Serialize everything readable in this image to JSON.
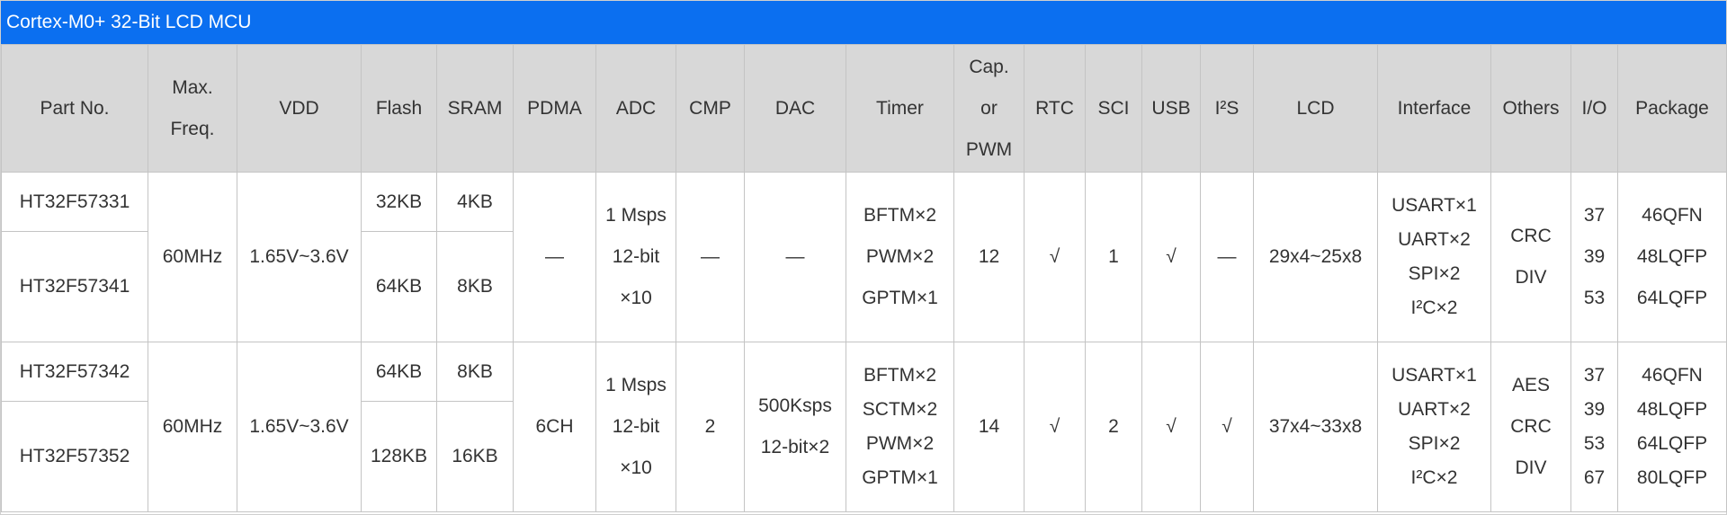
{
  "title": "Cortex-M0+ 32-Bit LCD MCU",
  "headers": [
    {
      "lines": [
        "Part No."
      ]
    },
    {
      "lines": [
        "Max.",
        "Freq."
      ]
    },
    {
      "lines": [
        "VDD"
      ]
    },
    {
      "lines": [
        "Flash"
      ]
    },
    {
      "lines": [
        "SRAM"
      ]
    },
    {
      "lines": [
        "PDMA"
      ]
    },
    {
      "lines": [
        "ADC"
      ]
    },
    {
      "lines": [
        "CMP"
      ]
    },
    {
      "lines": [
        "DAC"
      ]
    },
    {
      "lines": [
        "Timer"
      ]
    },
    {
      "lines": [
        "Cap.",
        "or",
        "PWM"
      ]
    },
    {
      "lines": [
        "RTC"
      ]
    },
    {
      "lines": [
        "SCI"
      ]
    },
    {
      "lines": [
        "USB"
      ]
    },
    {
      "lines": [
        "I²S"
      ]
    },
    {
      "lines": [
        "LCD"
      ]
    },
    {
      "lines": [
        "Interface"
      ]
    },
    {
      "lines": [
        "Others"
      ]
    },
    {
      "lines": [
        "I/O"
      ]
    },
    {
      "lines": [
        "Package"
      ]
    }
  ],
  "groups": [
    {
      "parts": [
        {
          "part_no": "HT32F57331",
          "flash": "32KB",
          "sram": "4KB"
        },
        {
          "part_no": "HT32F57341",
          "flash": "64KB",
          "sram": "8KB"
        }
      ],
      "max_freq": "60MHz",
      "vdd": "1.65V~3.6V",
      "pdma": "—",
      "adc": [
        "1 Msps",
        "12-bit",
        "×10"
      ],
      "cmp": "—",
      "dac": [
        "—"
      ],
      "timer": [
        "BFTM×2",
        "PWM×2",
        "GPTM×1"
      ],
      "cap_pwm": "12",
      "rtc": "√",
      "sci": "1",
      "usb": "√",
      "i2s": "—",
      "lcd": "29x4~25x8",
      "interface": [
        "USART×1",
        "UART×2",
        "SPI×2",
        "I²C×2"
      ],
      "others": [
        "CRC",
        "DIV"
      ],
      "io": [
        "37",
        "39",
        "53"
      ],
      "package": [
        "46QFN",
        "48LQFP",
        "64LQFP"
      ]
    },
    {
      "parts": [
        {
          "part_no": "HT32F57342",
          "flash": "64KB",
          "sram": "8KB"
        },
        {
          "part_no": "HT32F57352",
          "flash": "128KB",
          "sram": "16KB"
        }
      ],
      "max_freq": "60MHz",
      "vdd": "1.65V~3.6V",
      "pdma": "6CH",
      "adc": [
        "1 Msps",
        "12-bit",
        "×10"
      ],
      "cmp": "2",
      "dac": [
        "500Ksps",
        "12-bit×2"
      ],
      "timer": [
        "BFTM×2",
        "SCTM×2",
        "PWM×2",
        "GPTM×1"
      ],
      "cap_pwm": "14",
      "rtc": "√",
      "sci": "2",
      "usb": "√",
      "i2s": "√",
      "lcd": "37x4~33x8",
      "interface": [
        "USART×1",
        "UART×2",
        "SPI×2",
        "I²C×2"
      ],
      "others": [
        "AES",
        "CRC",
        "DIV"
      ],
      "io": [
        "37",
        "39",
        "53",
        "67"
      ],
      "package": [
        "46QFN",
        "48LQFP",
        "64LQFP",
        "80LQFP"
      ]
    }
  ]
}
